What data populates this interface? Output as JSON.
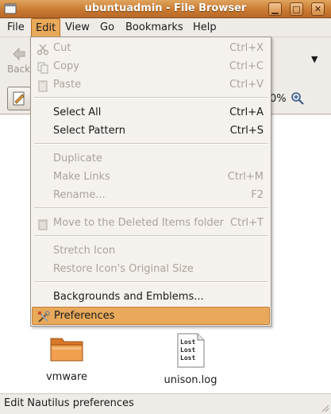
{
  "window": {
    "title": "ubuntuadmin - File Browser",
    "min_glyph": "▁",
    "max_glyph": "□",
    "close_glyph": "✕"
  },
  "menubar": [
    {
      "label": "File"
    },
    {
      "label": "Edit"
    },
    {
      "label": "View"
    },
    {
      "label": "Go"
    },
    {
      "label": "Bookmarks"
    },
    {
      "label": "Help"
    }
  ],
  "toolbar": {
    "back_label": "Back",
    "more_glyph": "▼",
    "zoom_text": "0%"
  },
  "edit_menu": {
    "cut": {
      "label": "Cut",
      "accel": "Ctrl+X"
    },
    "copy": {
      "label": "Copy",
      "accel": "Ctrl+C"
    },
    "paste": {
      "label": "Paste",
      "accel": "Ctrl+V"
    },
    "select_all": {
      "label": "Select All",
      "accel": "Ctrl+A"
    },
    "select_pattern": {
      "label": "Select Pattern",
      "accel": "Ctrl+S"
    },
    "duplicate": {
      "label": "Duplicate",
      "accel": ""
    },
    "make_links": {
      "label": "Make Links",
      "accel": "Ctrl+M"
    },
    "rename": {
      "label": "Rename...",
      "accel": "F2"
    },
    "move_to_trash": {
      "label": "Move to the Deleted Items folder",
      "accel": "Ctrl+T"
    },
    "stretch_icon": {
      "label": "Stretch Icon",
      "accel": ""
    },
    "restore_icon": {
      "label": "Restore Icon's Original Size",
      "accel": ""
    },
    "backgrounds": {
      "label": "Backgrounds and Emblems...",
      "accel": ""
    },
    "preferences": {
      "label": "Preferences",
      "accel": ""
    }
  },
  "files": [
    {
      "name": "vmware",
      "type": "folder"
    },
    {
      "name": "unison.log",
      "type": "text-file",
      "preview_lines": [
        "Lost",
        "Lost",
        "Lost"
      ]
    }
  ],
  "statusbar": {
    "text": "Edit Nautilus preferences"
  },
  "colors": {
    "titlebar": "#c8782f",
    "highlight": "#e8a95b"
  }
}
